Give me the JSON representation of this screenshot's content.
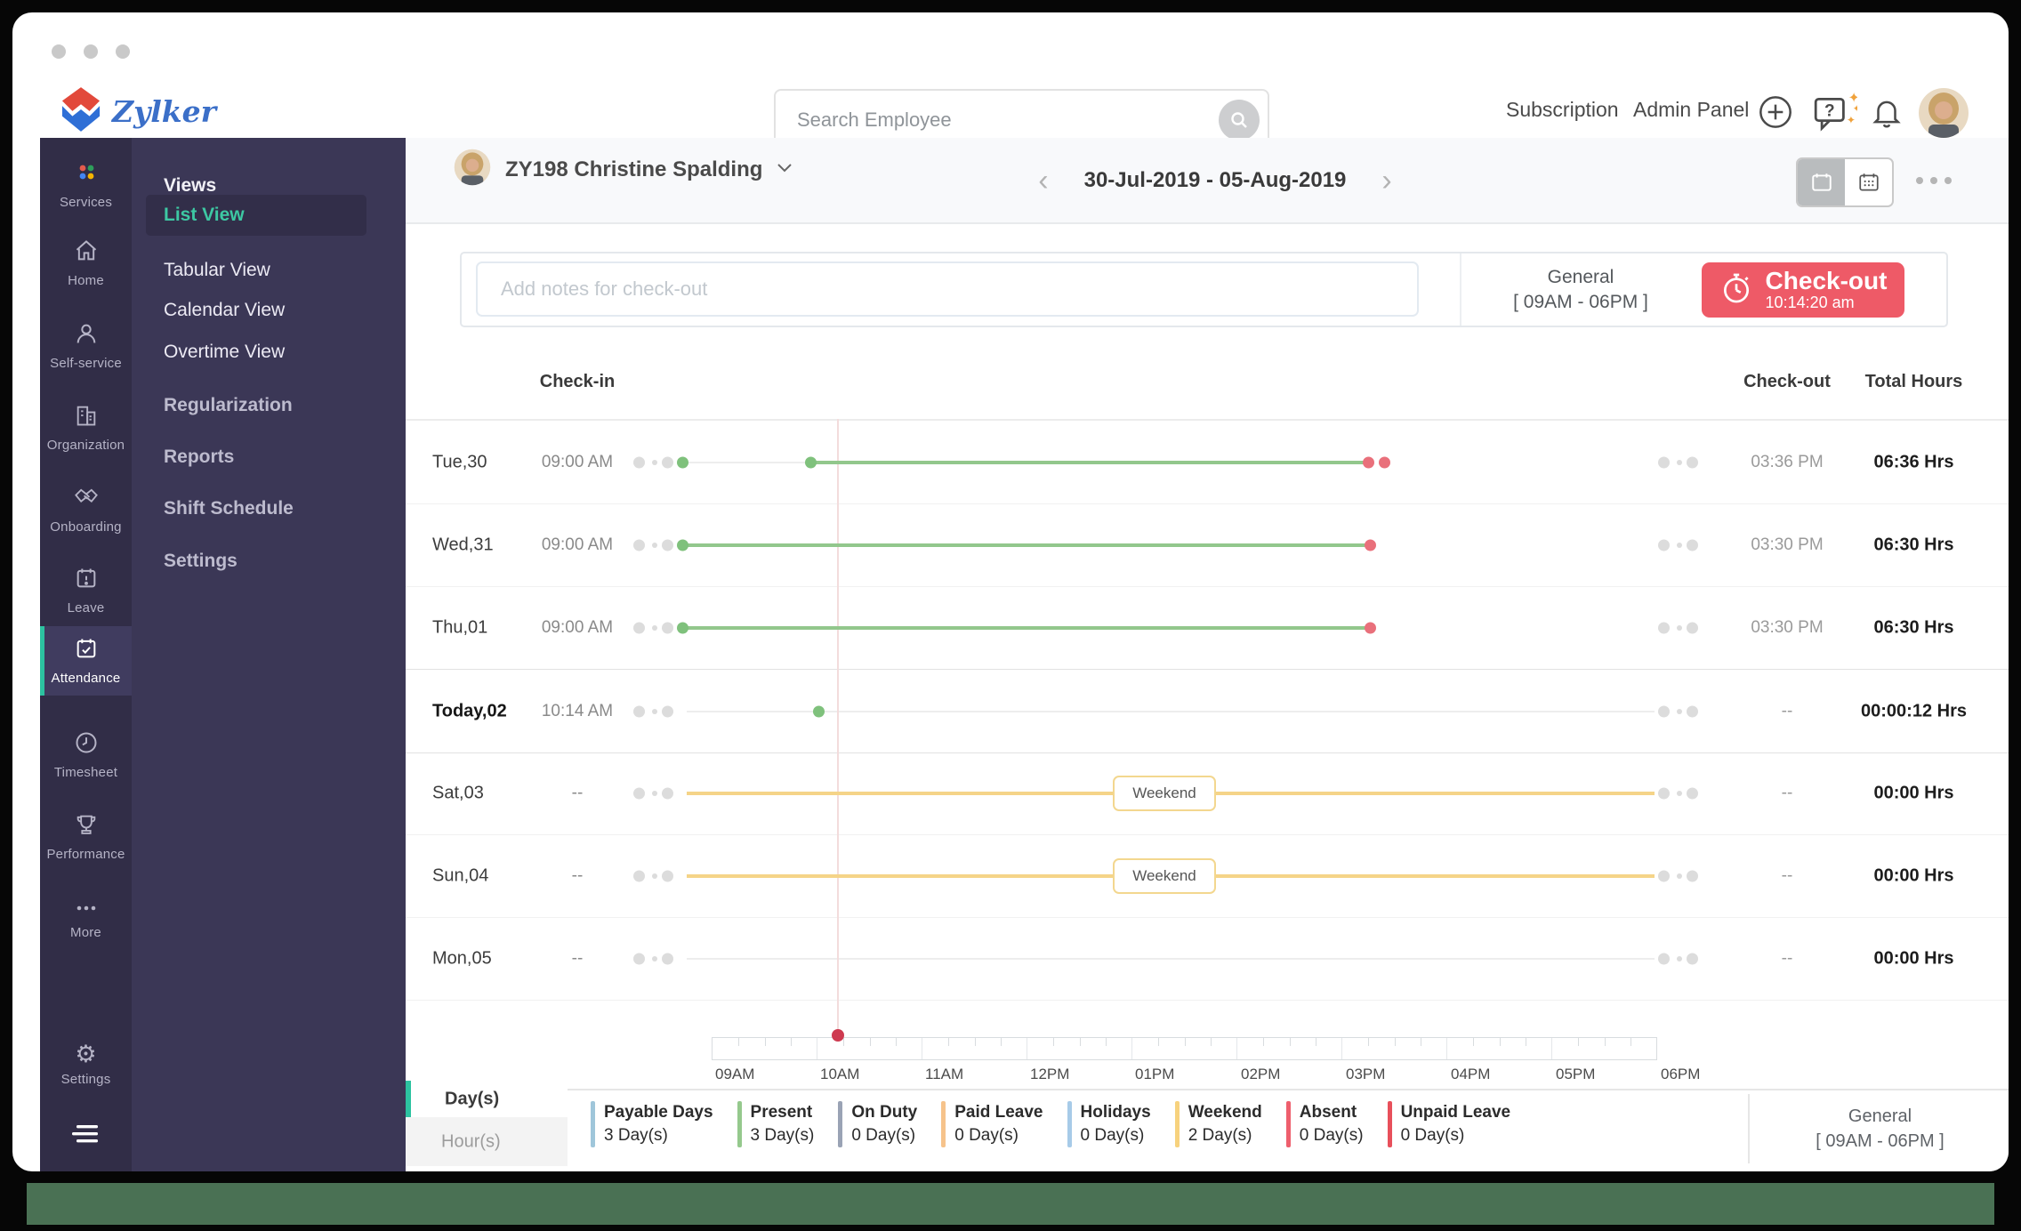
{
  "header": {
    "logo_text": "Zylker",
    "search": {
      "placeholder": "Search Employee"
    },
    "links": {
      "subscription": "Subscription",
      "admin_panel": "Admin Panel"
    }
  },
  "sidebar": {
    "items": [
      {
        "label": "Services"
      },
      {
        "label": "Home"
      },
      {
        "label": "Self-service"
      },
      {
        "label": "Organization"
      },
      {
        "label": "Onboarding"
      },
      {
        "label": "Leave"
      },
      {
        "label": "Attendance",
        "active": true
      },
      {
        "label": "Timesheet"
      },
      {
        "label": "Performance"
      },
      {
        "label": "More"
      },
      {
        "label": "Settings"
      }
    ]
  },
  "menu": {
    "section_title": "Views",
    "active_view": "List View",
    "view_items": [
      {
        "label": "List View"
      },
      {
        "label": "Tabular View"
      },
      {
        "label": "Calendar View"
      },
      {
        "label": "Overtime View"
      }
    ],
    "items": [
      {
        "label": "Regularization"
      },
      {
        "label": "Reports"
      },
      {
        "label": "Shift Schedule"
      },
      {
        "label": "Settings"
      }
    ]
  },
  "toolbar": {
    "employee": "ZY198 Christine Spalding",
    "prev": "‹",
    "date_range": "30-Jul-2019  -  05-Aug-2019",
    "next": "›"
  },
  "checkout_panel": {
    "notes_placeholder": "Add notes for check-out",
    "shift_name": "General",
    "shift_time": "[ 09AM - 06PM ]",
    "button_label": "Check-out",
    "button_time": "10:14:20 am"
  },
  "table": {
    "headers": {
      "checkin": "Check-in",
      "checkout": "Check-out",
      "total": "Total Hours"
    },
    "rows": [
      {
        "day": "Tue,30",
        "checkin": "09:00 AM",
        "checkout": "03:36 PM",
        "total": "06:36 Hrs"
      },
      {
        "day": "Wed,31",
        "checkin": "09:00 AM",
        "checkout": "03:30 PM",
        "total": "06:30 Hrs"
      },
      {
        "day": "Thu,01",
        "checkin": "09:00 AM",
        "checkout": "03:30 PM",
        "total": "06:30 Hrs"
      },
      {
        "day": "Today,02",
        "checkin": "10:14 AM",
        "checkout": "--",
        "total": "00:00:12 Hrs"
      },
      {
        "day": "Sat,03",
        "checkin": "--",
        "checkout": "--",
        "total": "00:00 Hrs",
        "band": "Weekend"
      },
      {
        "day": "Sun,04",
        "checkin": "--",
        "checkout": "--",
        "total": "00:00 Hrs",
        "band": "Weekend"
      },
      {
        "day": "Mon,05",
        "checkin": "--",
        "checkout": "--",
        "total": "00:00 Hrs"
      }
    ]
  },
  "axis": {
    "labels": [
      "09AM",
      "10AM",
      "11AM",
      "12PM",
      "01PM",
      "02PM",
      "03PM",
      "04PM",
      "05PM",
      "06PM"
    ],
    "current_time_marker": "10:14 AM"
  },
  "summary": {
    "tabs": {
      "days": "Day(s)",
      "hours": "Hour(s)",
      "active": "Day(s)"
    },
    "legend": [
      {
        "name": "Payable Days",
        "value": "3 Day(s)",
        "color": "#9fc6da"
      },
      {
        "name": "Present",
        "value": "3 Day(s)",
        "color": "#95c98d"
      },
      {
        "name": "On Duty",
        "value": "0 Day(s)",
        "color": "#9aa3b5"
      },
      {
        "name": "Paid Leave",
        "value": "0 Day(s)",
        "color": "#f6c38b"
      },
      {
        "name": "Holidays",
        "value": "0 Day(s)",
        "color": "#a7cbe8"
      },
      {
        "name": "Weekend",
        "value": "2 Day(s)",
        "color": "#f7d27e"
      },
      {
        "name": "Absent",
        "value": "0 Day(s)",
        "color": "#ee5f6d"
      },
      {
        "name": "Unpaid Leave",
        "value": "0 Day(s)",
        "color": "#e8505b"
      }
    ],
    "shift_name": "General",
    "shift_time": "[ 09AM - 06PM ]"
  },
  "colors": {
    "accent_teal": "#2cc2a0",
    "checkout_red": "#ee5a67",
    "present_green": "#92c78c",
    "weekend_yellow": "#f5d488",
    "sidebar_dark": "#312d47",
    "sidebar_panel": "#3b3756"
  }
}
